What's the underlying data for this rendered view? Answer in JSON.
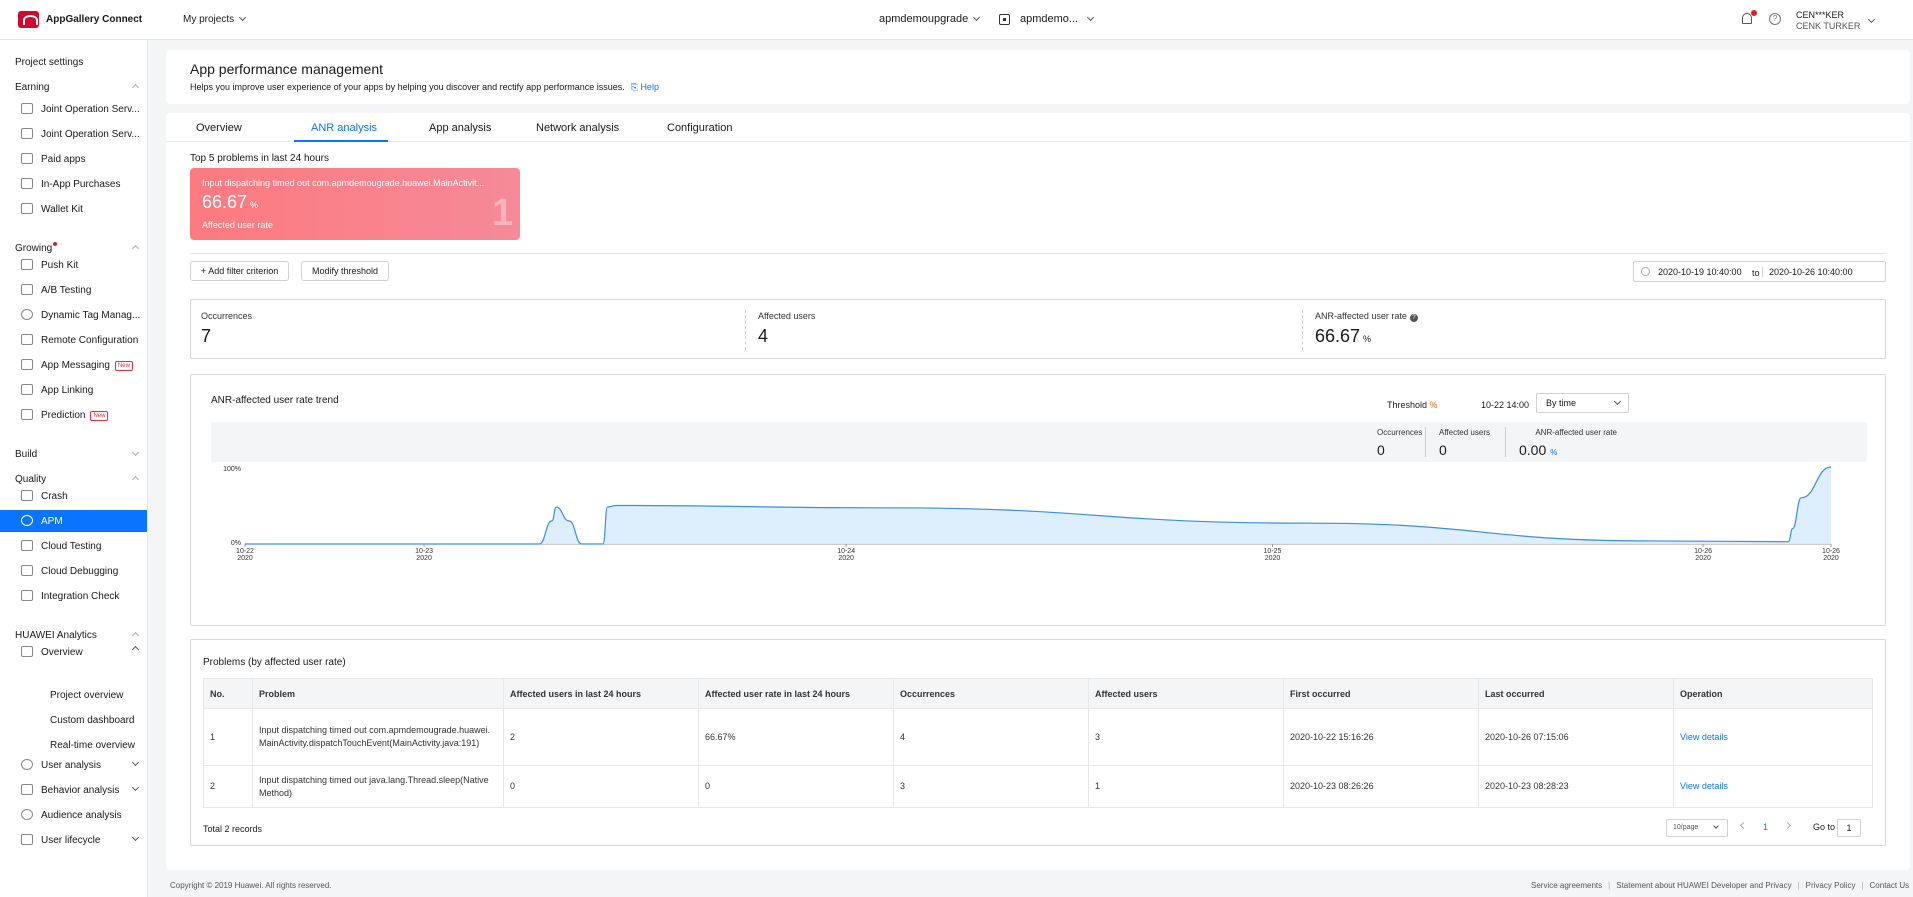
{
  "topbar": {
    "brand": "AppGallery Connect",
    "projects": "My projects",
    "app1": "apmdemoupgrade",
    "app2": "apmdemo...",
    "user_line1": "CEN***KER",
    "user_line2": "CENK TURKER"
  },
  "sidebar": {
    "project_settings": "Project settings",
    "earning": "Earning",
    "earning_items": [
      "Joint Operation Serv...",
      "Joint Operation Serv...",
      "Paid apps",
      "In-App Purchases",
      "Wallet Kit"
    ],
    "growing": "Growing",
    "growing_items": [
      "Push Kit",
      "A/B Testing",
      "Dynamic Tag Manag...",
      "Remote Configuration",
      "App Messaging",
      "App Linking",
      "Prediction"
    ],
    "new_tag": "New",
    "build": "Build",
    "quality": "Quality",
    "quality_items": [
      "Crash",
      "APM",
      "Cloud Testing",
      "Cloud Debugging",
      "Integration Check"
    ],
    "analytics": "HUAWEI Analytics",
    "overview": "Overview",
    "overview_subs": [
      "Project overview",
      "Custom dashboard",
      "Real-time overview"
    ],
    "analytics_items": [
      "User analysis",
      "Behavior analysis",
      "Audience analysis",
      "User lifecycle"
    ]
  },
  "header": {
    "title": "App performance management",
    "desc": "Helps you improve user experience of your apps by helping you discover and rectify app performance issues.",
    "help": "Help"
  },
  "tabs": [
    "Overview",
    "ANR analysis",
    "App analysis",
    "Network analysis",
    "Configuration"
  ],
  "top5": {
    "title": "Top 5 problems in last 24 hours",
    "problem": "Input dispatching timed out com.apmdemougrade.huawei.MainActivit...",
    "value": "66.67",
    "unit": "%",
    "label": "Affected user rate",
    "rank": "1"
  },
  "filters": {
    "add": "+ Add filter criterion",
    "modify": "Modify threshold",
    "date_from": "2020-10-19 10:40:00",
    "to": "to",
    "date_to": "2020-10-26 10:40:00"
  },
  "metrics": {
    "occ_label": "Occurrences",
    "occ_value": "7",
    "users_label": "Affected users",
    "users_value": "4",
    "rate_label": "ANR-affected user rate",
    "rate_value": "66.67",
    "rate_unit": "%"
  },
  "trend": {
    "title": "ANR-affected user rate trend",
    "threshold": "Threshold",
    "threshold_unit": "%",
    "date": "10-22 14:00",
    "by": "By time",
    "tt_occ_label": "Occurrences",
    "tt_occ": "0",
    "tt_users_label": "Affected users",
    "tt_users": "0",
    "tt_rate_label": "ANR-affected user rate",
    "tt_rate": "0.00",
    "tt_rate_unit": "%"
  },
  "chart_data": {
    "type": "area",
    "y_ticks": [
      "100%",
      "0%"
    ],
    "ylim": [
      0,
      100
    ],
    "x_ticks": [
      {
        "date": "10-22",
        "year": "2020"
      },
      {
        "date": "10-23",
        "year": "2020"
      },
      {
        "date": "10-24",
        "year": "2020"
      },
      {
        "date": "10-25",
        "year": "2020"
      },
      {
        "date": "10-26",
        "year": "2020"
      },
      {
        "date": "10-26",
        "year": "2020"
      }
    ],
    "x_days": [
      0,
      0.42,
      1.41,
      2.41,
      3.42,
      3.72
    ],
    "series": [
      {
        "x": [
          0,
          0.69,
          0.72,
          0.73,
          0.76,
          0.79,
          0.84,
          0.85,
          0.87,
          1.5,
          2.5,
          3.3,
          3.62,
          3.63,
          3.65,
          3.72
        ],
        "values": [
          0,
          0,
          30,
          48,
          30,
          0,
          0,
          48,
          50,
          47,
          27,
          4,
          3,
          20,
          60,
          100
        ]
      }
    ]
  },
  "problems": {
    "title": "Problems (by affected user rate)",
    "columns": [
      "No.",
      "Problem",
      "Affected users in last 24 hours",
      "Affected user rate in last 24 hours",
      "Occurrences",
      "Affected users",
      "First occurred",
      "Last occurred",
      "Operation"
    ],
    "rows": [
      [
        "1",
        "Input dispatching timed out com.apmdemougrade.huawei.MainActivity.dispatchTouchEvent(MainActivity.java:191)",
        "2",
        "66.67%",
        "4",
        "3",
        "2020-10-22 15:16:26",
        "2020-10-26 07:15:06",
        "View details"
      ],
      [
        "2",
        "Input dispatching timed out java.lang.Thread.sleep(Native Method)",
        "0",
        "0",
        "3",
        "1",
        "2020-10-23 08:26:26",
        "2020-10-23 08:28:23",
        "View details"
      ]
    ],
    "total": "Total 2 records",
    "page_size": "10/page",
    "page": "1",
    "goto": "Go to",
    "goto_value": "1"
  },
  "footer": {
    "copyright": "Copyright © 2019 Huawei. All rights reserved.",
    "links": [
      "Service agreements",
      "Statement about HUAWEI Developer and Privacy",
      "Privacy Policy",
      "Contact Us"
    ]
  },
  "colors": {
    "accent": "#0a74ff",
    "danger": "#e02020",
    "card": "#fd7a7f"
  }
}
